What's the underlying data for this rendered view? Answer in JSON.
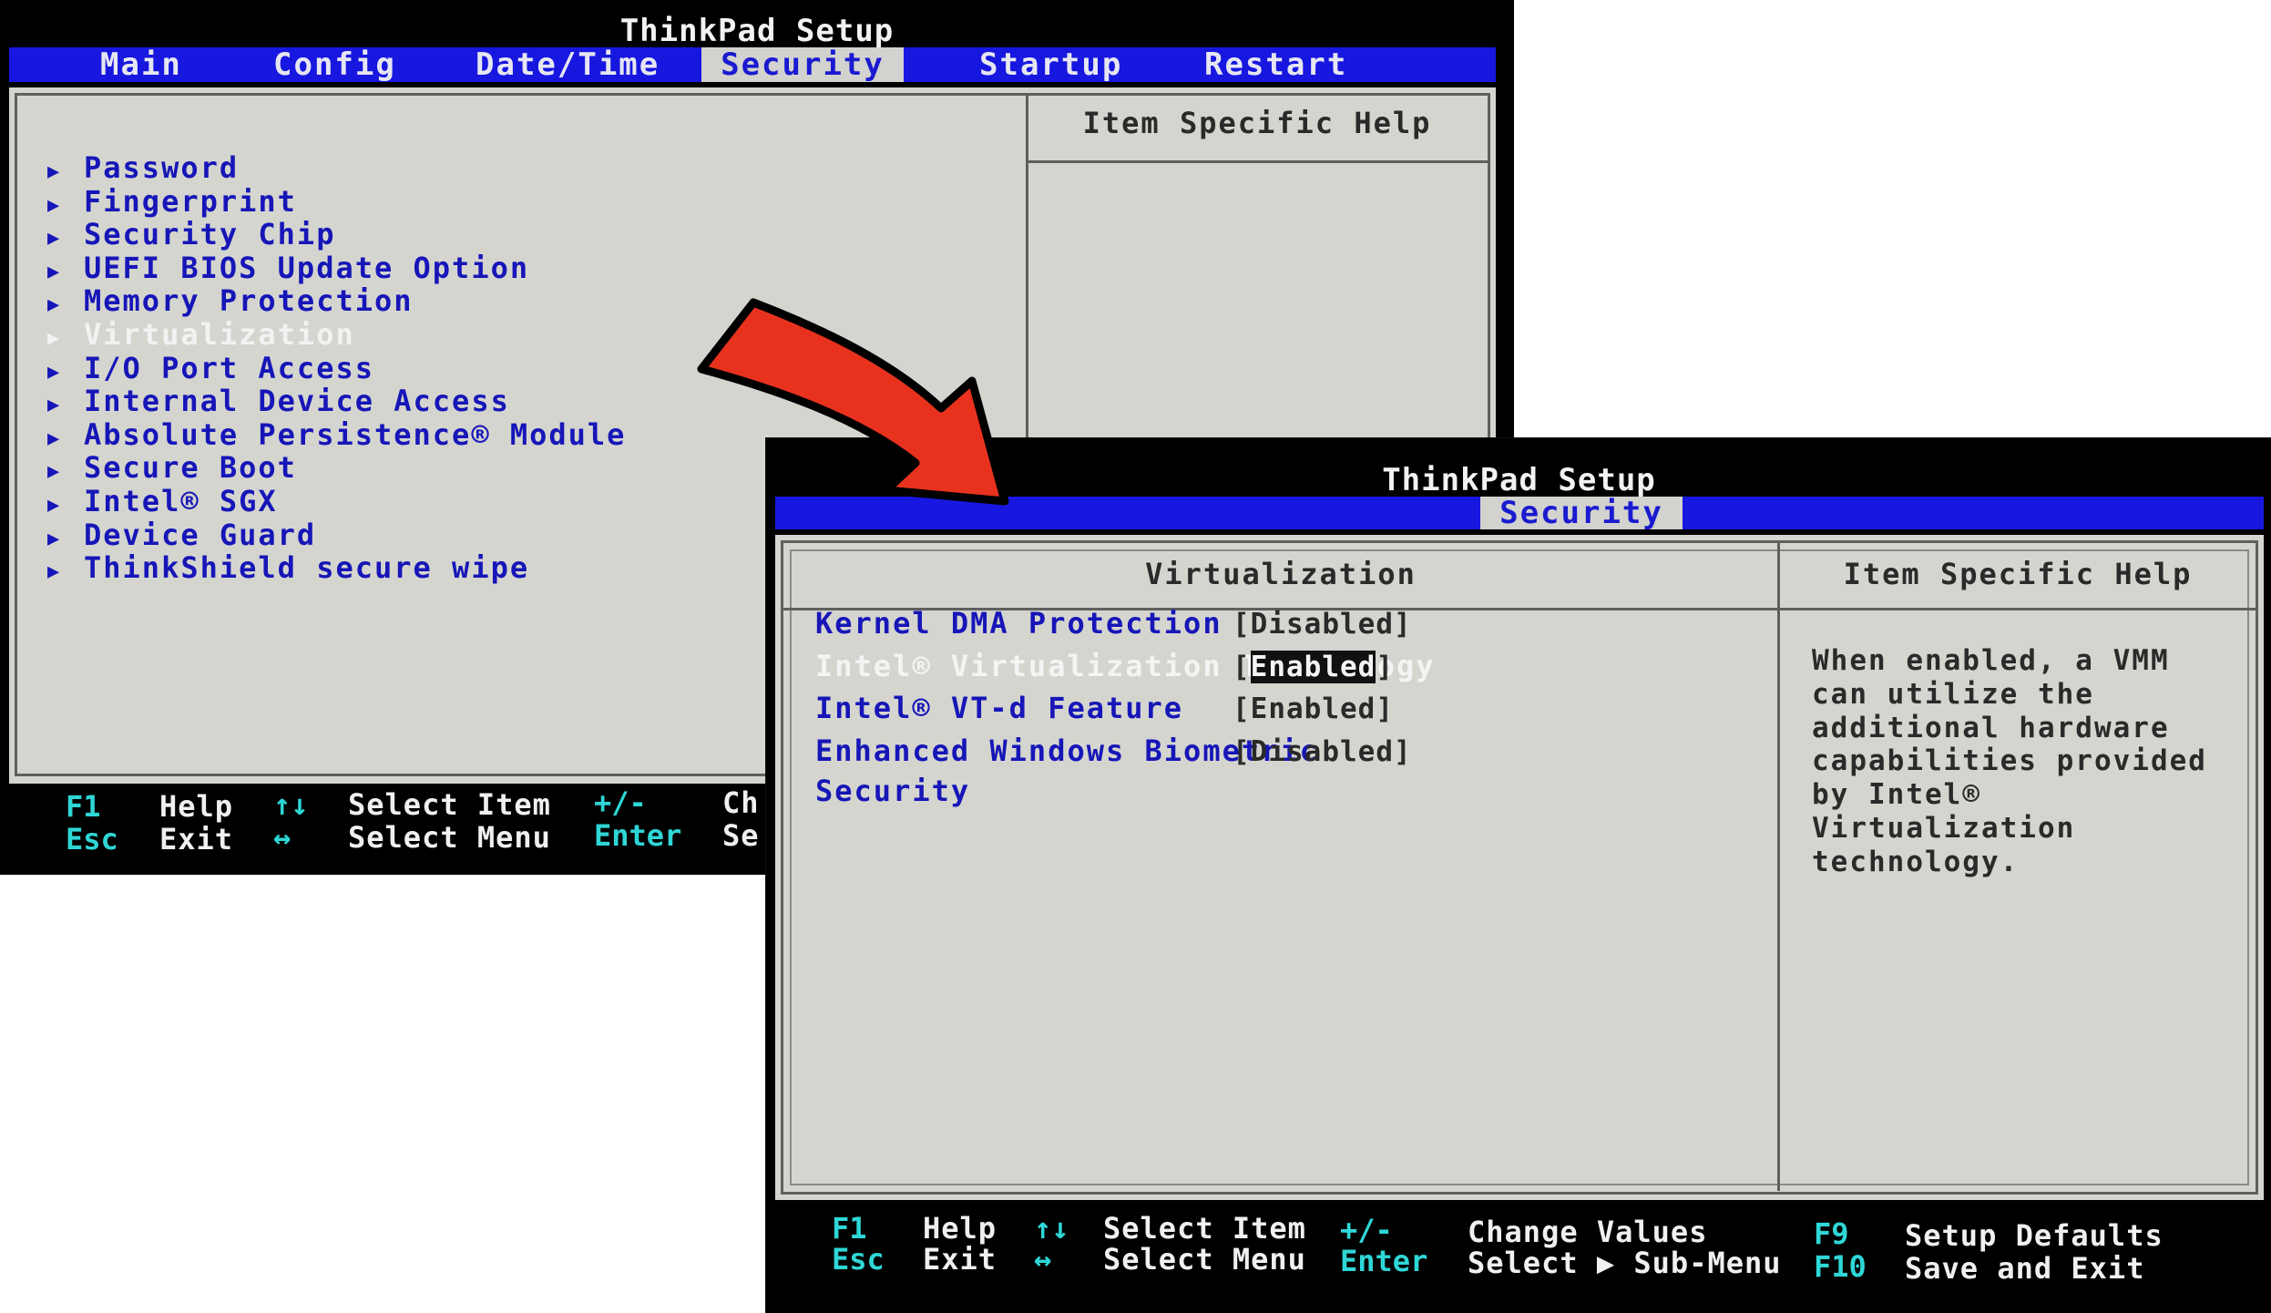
{
  "screen_a": {
    "title": "ThinkPad Setup",
    "tabs": [
      {
        "label": "Main",
        "active": false
      },
      {
        "label": "Config",
        "active": false
      },
      {
        "label": "Date/Time",
        "active": false
      },
      {
        "label": "Security",
        "active": true
      },
      {
        "label": "Startup",
        "active": false
      },
      {
        "label": "Restart",
        "active": false
      }
    ],
    "help_heading": "Item Specific Help",
    "menu_items": [
      {
        "label": "Password",
        "selected": false
      },
      {
        "label": "Fingerprint",
        "selected": false
      },
      {
        "label": "Security Chip",
        "selected": false
      },
      {
        "label": "UEFI BIOS Update Option",
        "selected": false
      },
      {
        "label": "Memory Protection",
        "selected": false
      },
      {
        "label": "Virtualization",
        "selected": true
      },
      {
        "label": "I/O Port Access",
        "selected": false
      },
      {
        "label": "Internal Device Access",
        "selected": false
      },
      {
        "label": "Absolute Persistence® Module",
        "selected": false
      },
      {
        "label": "Secure Boot",
        "selected": false
      },
      {
        "label": "Intel® SGX",
        "selected": false
      },
      {
        "label": "Device Guard",
        "selected": false
      },
      {
        "label": "ThinkShield secure wipe",
        "selected": false
      }
    ],
    "footer": {
      "f1_key": "F1",
      "f1_desc": "Help",
      "esc_key": "Esc",
      "esc_desc": "Exit",
      "updown_key": "↑↓",
      "updown_desc": "Select Item",
      "leftright_key": "↔",
      "leftright_desc": "Select Menu",
      "plusminus_key": "+/-",
      "enter_key": "Enter",
      "change_partial": "Ch",
      "select_partial": "Se"
    }
  },
  "screen_b": {
    "title": "ThinkPad Setup",
    "active_tab": "Security",
    "panel_heading": "Virtualization",
    "help_heading": "Item Specific Help",
    "settings": [
      {
        "label": "Kernel DMA Protection",
        "value": "Disabled",
        "selected": false,
        "highlight": false
      },
      {
        "label": "Intel® Virtualization Technology",
        "value": "Enabled",
        "selected": true,
        "highlight": true
      },
      {
        "label": "Intel® VT-d Feature",
        "value": "Enabled",
        "selected": false,
        "highlight": false
      },
      {
        "label": "Enhanced Windows Biometric",
        "label2": "Security",
        "value": "Disabled",
        "selected": false,
        "highlight": false
      }
    ],
    "help_text": "When enabled, a VMM\ncan utilize the\nadditional hardware\ncapabilities provided\nby Intel®\nVirtualization\ntechnology.",
    "footer": {
      "f1_key": "F1",
      "f1_desc": "Help",
      "esc_key": "Esc",
      "esc_desc": "Exit",
      "updown_key": "↑↓",
      "updown_desc": "Select Item",
      "leftright_key": "↔",
      "leftright_desc": "Select Menu",
      "plusminus_key": "+/-",
      "plusminus_desc": "Change Values",
      "enter_key": "Enter",
      "enter_desc": "Select ▶ Sub-Menu",
      "f9_key": "F9",
      "f9_desc": "Setup Defaults",
      "f10_key": "F10",
      "f10_desc": "Save and Exit"
    }
  },
  "colors": {
    "menubar_blue": "#1717e0",
    "panel_gray": "#d5d5d0",
    "item_blue": "#1616b8",
    "key_cyan": "#2fd6d6",
    "arrow_red": "#e8321e"
  },
  "icons": {
    "submenu_marker": "triangle-right-icon",
    "annotation": "red-arrow-icon"
  }
}
